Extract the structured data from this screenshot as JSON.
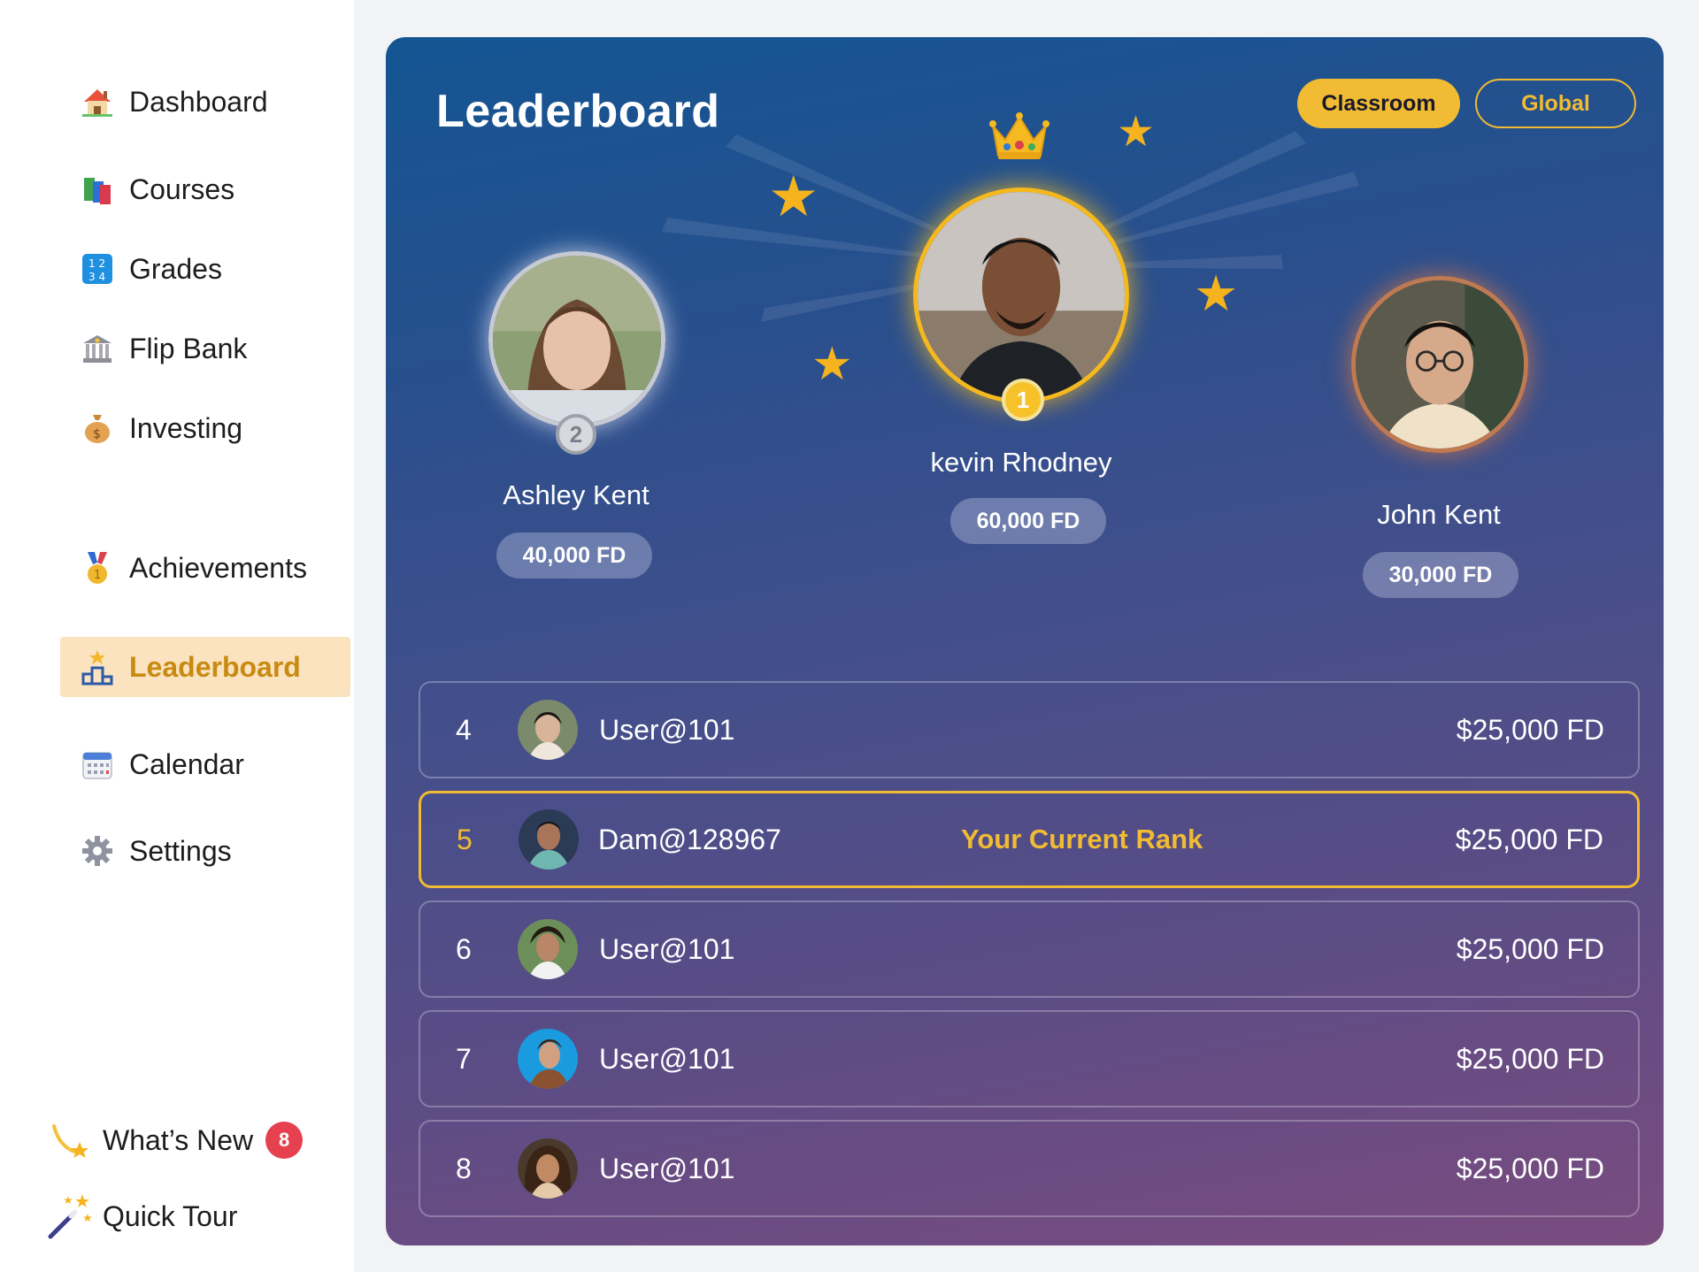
{
  "sidebar": {
    "items": [
      {
        "label": "Dashboard",
        "icon": "house-icon"
      },
      {
        "label": "Courses",
        "icon": "books-icon"
      },
      {
        "label": "Grades",
        "icon": "numbers-icon"
      },
      {
        "label": "Flip Bank",
        "icon": "bank-icon"
      },
      {
        "label": "Investing",
        "icon": "money-bag-icon"
      },
      {
        "label": "Achievements",
        "icon": "medal-icon"
      },
      {
        "label": "Leaderboard",
        "icon": "podium-icon",
        "active": true
      },
      {
        "label": "Calendar",
        "icon": "calendar-icon"
      },
      {
        "label": "Settings",
        "icon": "gear-icon"
      }
    ],
    "whats_new": {
      "label": "What’s New",
      "count": "8"
    },
    "quick_tour": {
      "label": "Quick Tour"
    }
  },
  "main": {
    "title": "Leaderboard",
    "tabs": [
      {
        "label": "Classroom",
        "active": true
      },
      {
        "label": "Global",
        "active": false
      }
    ],
    "podium": {
      "first": {
        "name": "kevin Rhodney",
        "score": "60,000 FD",
        "rank": "1"
      },
      "second": {
        "name": "Ashley Kent",
        "score": "40,000 FD",
        "rank": "2"
      },
      "third": {
        "name": "John Kent",
        "score": "30,000 FD"
      }
    },
    "rows": [
      {
        "rank": "4",
        "user": "User@101",
        "amount": "$25,000 FD"
      },
      {
        "rank": "5",
        "user": "Dam@128967",
        "note": "Your Current Rank",
        "amount": "$25,000 FD",
        "current": true
      },
      {
        "rank": "6",
        "user": "User@101",
        "amount": "$25,000 FD"
      },
      {
        "rank": "7",
        "user": "User@101",
        "amount": "$25,000 FD"
      },
      {
        "rank": "8",
        "user": "User@101",
        "amount": "$25,000 FD"
      }
    ]
  },
  "colors": {
    "accent": "#f1bb33",
    "active_bg": "#fbe3bf",
    "active_text": "#c88a12",
    "badge": "#e5414f",
    "panel_top": "#135592",
    "panel_bottom": "#7a4c80"
  }
}
